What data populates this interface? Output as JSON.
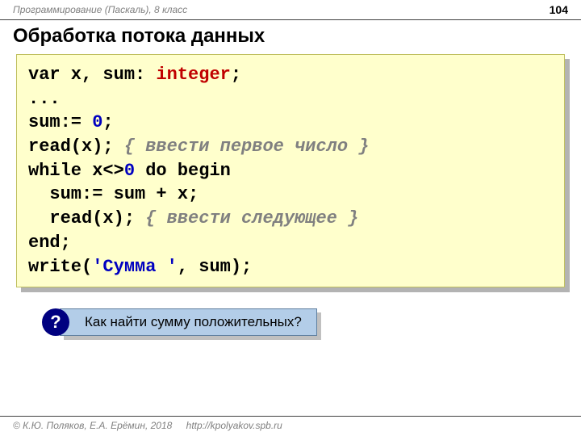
{
  "header": {
    "course": "Программирование (Паскаль), 8 класс",
    "page": "104"
  },
  "title": "Обработка потока данных",
  "code": {
    "l1a": "var x, sum: ",
    "l1b": "integer",
    "l1c": ";",
    "l2": "...",
    "l3a": "sum:= ",
    "l3b": "0",
    "l3c": ";",
    "l4a": "read(x)",
    "l4b": "; ",
    "l4c": "{ ввести первое число }",
    "l5a": "while x<>",
    "l5b": "0",
    "l5c": " do begin",
    "l6": "  sum:= sum + x;",
    "l7a": "  read(x)",
    "l7b": "; ",
    "l7c": "{ ввести следующее }",
    "l8": "end;",
    "l9a": "write(",
    "l9b": "'Сумма '",
    "l9c": ", sum);"
  },
  "question": {
    "badge": "?",
    "text": "Как найти сумму положительных?"
  },
  "footer": {
    "copyright": "© К.Ю. Поляков, Е.А. Ерёмин, 2018",
    "url": "http://kpolyakov.spb.ru"
  }
}
